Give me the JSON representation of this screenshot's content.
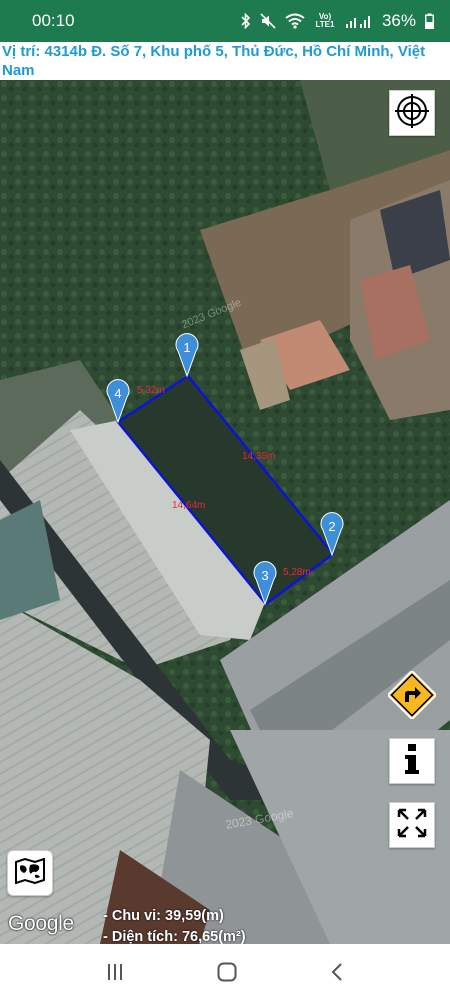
{
  "status_bar": {
    "time": "00:10",
    "battery": "36%",
    "icons": [
      "bluetooth-icon",
      "mute-icon",
      "wifi-icon",
      "volte-icon",
      "signal-icon",
      "battery-icon"
    ],
    "volte_label": "Vo) LTE1"
  },
  "location": {
    "text": " Vị trí: 4314b Đ. Số 7, Khu phố 5, Thủ Đức, Hồ Chí Minh, Việt Nam"
  },
  "map": {
    "markers": [
      {
        "label": "1"
      },
      {
        "label": "2"
      },
      {
        "label": "3"
      },
      {
        "label": "4"
      }
    ],
    "edges": [
      {
        "label": "5,32m"
      },
      {
        "label": "14,35m"
      },
      {
        "label": "5,28m"
      },
      {
        "label": "14,64m"
      }
    ],
    "watermarks": [
      "2023 Google",
      "2023 Google"
    ],
    "polygon_color": "#0a14d6",
    "marker_color": "#3d8fd8",
    "edge_label_color": "#e5293a"
  },
  "controls": {
    "locate": "crosshair-icon",
    "directions": "directions-sign-icon",
    "info": "info-icon",
    "fullscreen": "fullscreen-icon",
    "map_type": "map-type-icon"
  },
  "attribution": "Google",
  "stats": {
    "perimeter": "- Chu vi: 39,59(m)",
    "area": "- Diện tích: 76,65(m²)"
  },
  "nav_bar": {
    "icons": [
      "recent-apps-icon",
      "home-icon",
      "back-icon"
    ]
  }
}
